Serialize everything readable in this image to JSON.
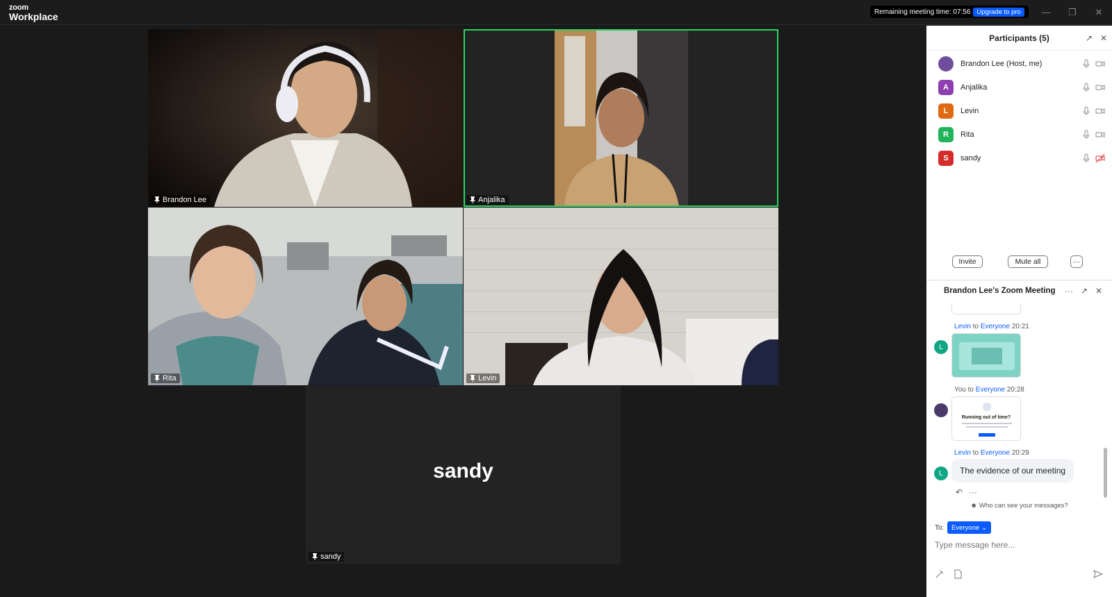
{
  "app": {
    "logo_top": "zoom",
    "logo_bottom": "Workplace"
  },
  "timer": {
    "label": "Remaining meeting time: 07:56",
    "upgrade": "Upgrade to pro"
  },
  "window_controls": [
    "minimize",
    "restore",
    "close"
  ],
  "tiles": [
    {
      "name": "Brandon Lee",
      "active": false
    },
    {
      "name": "Anjalika",
      "active": true
    },
    {
      "name": "Rita",
      "active": false
    },
    {
      "name": "Levin",
      "active": false
    },
    {
      "name": "sandy",
      "big_name": "sandy",
      "video_off": true
    }
  ],
  "participants": {
    "title": "Participants (5)",
    "list": [
      {
        "initial": "",
        "name": "Brandon Lee (Host, me)",
        "color": "#6f4e9c",
        "camera_off": false
      },
      {
        "initial": "A",
        "name": "Anjalika",
        "color": "#8e3fb0",
        "camera_off": false
      },
      {
        "initial": "L",
        "name": "Levin",
        "color": "#e06a11",
        "camera_off": false
      },
      {
        "initial": "R",
        "name": "Rita",
        "color": "#22b45b",
        "camera_off": false
      },
      {
        "initial": "S",
        "name": "sandy",
        "color": "#d42b2b",
        "camera_off": true
      }
    ],
    "invite": "Invite",
    "mute_all": "Mute all",
    "more": "···"
  },
  "chat": {
    "title": "Brandon Lee's Zoom Meeting",
    "messages": [
      {
        "from": "Levin",
        "to_word": "to",
        "to": "Everyone",
        "time": "20:21",
        "avatar": "L",
        "avatar_color": "#11a683",
        "type": "image"
      },
      {
        "from": "You",
        "to_word": "to",
        "to": "Everyone",
        "time": "20:28",
        "avatar": "",
        "avatar_color": "#4a3a6a",
        "type": "image",
        "image_text": "Running out of time?"
      },
      {
        "from": "Levin",
        "to_word": "to",
        "to": "Everyone",
        "time": "20:29",
        "avatar": "L",
        "avatar_color": "#11a683",
        "type": "text",
        "text": "The evidence of our meeting"
      }
    ],
    "who_can_see": "Who can see your messages?",
    "to_label": "To:",
    "to_value": "Everyone",
    "input_placeholder": "Type message here..."
  }
}
